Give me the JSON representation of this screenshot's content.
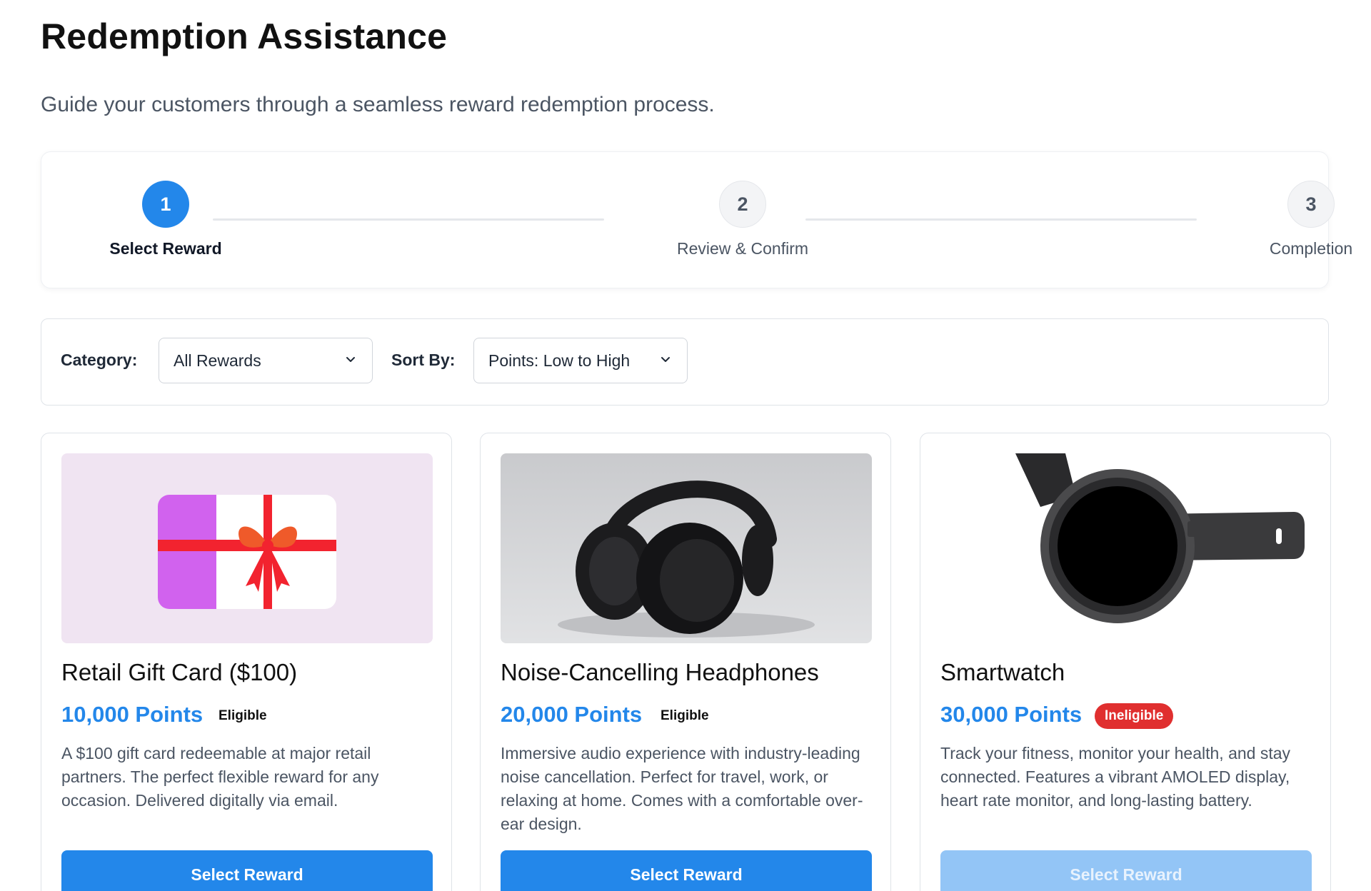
{
  "page": {
    "title": "Redemption Assistance",
    "subtitle": "Guide your customers through a seamless reward redemption process."
  },
  "stepper": {
    "steps": [
      {
        "number": "1",
        "label": "Select Reward",
        "state": "active"
      },
      {
        "number": "2",
        "label": "Review & Confirm",
        "state": "inactive"
      },
      {
        "number": "3",
        "label": "Completion",
        "state": "inactive"
      }
    ]
  },
  "filters": {
    "category_label": "Category:",
    "category_value": "All Rewards",
    "sort_label": "Sort By:",
    "sort_value": "Points: Low to High"
  },
  "rewards": [
    {
      "title": "Retail Gift Card ($100)",
      "points": "10,000 Points",
      "status": "Eligible",
      "description": "A $100 gift card redeemable at major retail partners. The perfect flexible reward for any occasion. Delivered digitally via email.",
      "button": "Select Reward",
      "image_icon": "gift-card-icon"
    },
    {
      "title": "Noise-Cancelling Headphones",
      "points": "20,000 Points",
      "status": "Eligible",
      "description": "Immersive audio experience with industry-leading noise cancellation. Perfect for travel, work, or relaxing at home. Comes with a comfortable over-ear design.",
      "button": "Select Reward",
      "image_icon": "headphones-icon"
    },
    {
      "title": "Smartwatch",
      "points": "30,000 Points",
      "status": "Ineligible",
      "description": "Track your fitness, monitor your health, and stay connected. Features a vibrant AMOLED display, heart rate monitor, and long-lasting battery.",
      "button": "Select Reward",
      "image_icon": "smartwatch-icon"
    }
  ],
  "colors": {
    "accent": "#2387ea",
    "ineligible": "#e02f2f",
    "disabled_button": "#93c5f6"
  }
}
